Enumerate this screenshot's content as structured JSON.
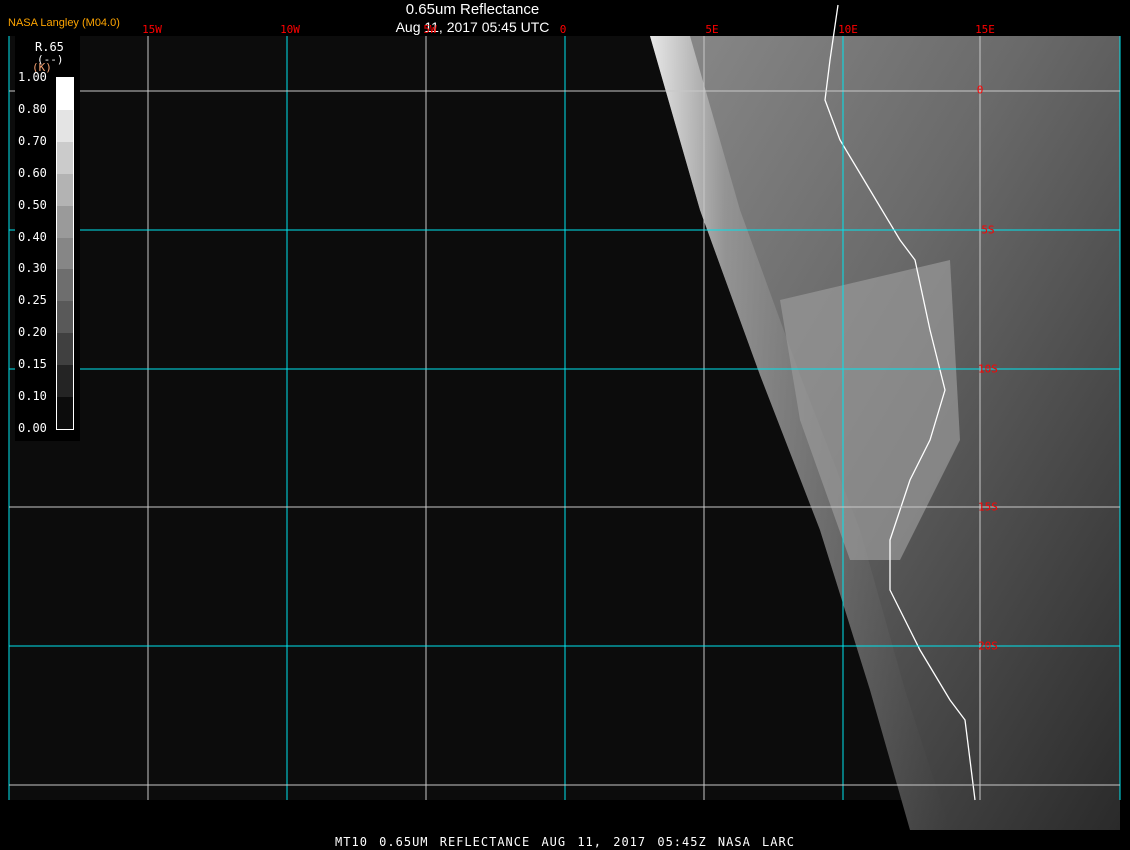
{
  "header": {
    "title": "0.65um Reflectance",
    "subtitle": "Aug 11, 2017 05:45 UTC",
    "brand": "NASA Langley (M04.0)"
  },
  "grid": {
    "longitudes": [
      "15W",
      "10W",
      "5W",
      "0",
      "5E",
      "10E",
      "15E"
    ],
    "latitudes": [
      "0",
      "5S",
      "10S",
      "15S",
      "20S"
    ]
  },
  "legend": {
    "variable": "R.65",
    "units": "(--)",
    "units_alt": "(K)",
    "ticks": [
      "1.00",
      "0.80",
      "0.70",
      "0.60",
      "0.50",
      "0.40",
      "0.30",
      "0.25",
      "0.20",
      "0.15",
      "0.10",
      "0.00"
    ],
    "colors": [
      "#ffffff",
      "#e4e4e4",
      "#cbcbcb",
      "#b3b3b3",
      "#9a9a9a",
      "#868686",
      "#6e6e6e",
      "#595959",
      "#404040",
      "#242424",
      "#0c0c0c"
    ]
  },
  "footer": "MT10  0.65UM REFLECTANCE   AUG 11, 2017 05:45Z   NASA LARC",
  "colors": {
    "grid_major": "#00e5ee",
    "grid_minor": "#c8c8c8",
    "label": "#ff0000",
    "brand": "#ffa500"
  }
}
